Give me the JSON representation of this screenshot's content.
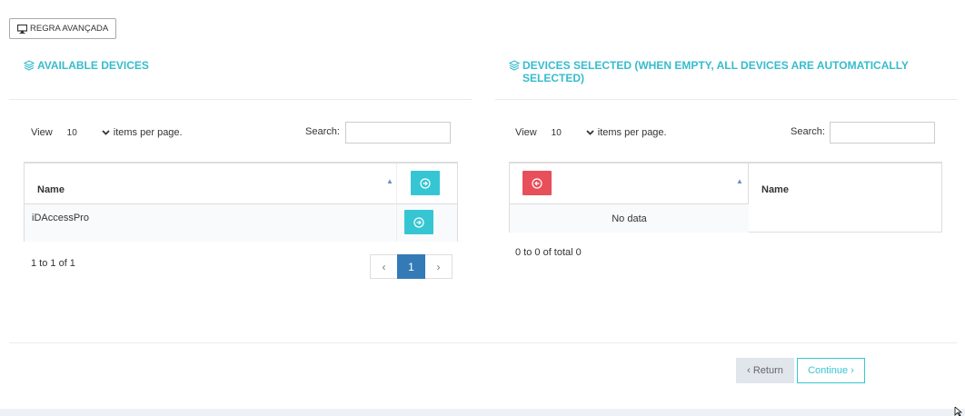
{
  "toolbar": {
    "advanced_rule_label": "REGRA AVANÇADA",
    "advanced_rule_icon": "monitor-icon"
  },
  "available": {
    "title": "AVAILABLE DEVICES",
    "view_label": "View",
    "page_size": "10",
    "items_per_page_label": "items per page.",
    "search_label": "Search:",
    "search_value": "",
    "column_name": "Name",
    "rows": [
      {
        "name": "iDAccessPro"
      }
    ],
    "summary": "1 to 1 of 1",
    "pager": {
      "prev": "‹",
      "current": "1",
      "next": "›"
    }
  },
  "selected": {
    "title": "DEVICES SELECTED (WHEN EMPTY, ALL DEVICES ARE AUTOMATICALLY SELECTED)",
    "view_label": "View",
    "page_size": "10",
    "items_per_page_label": "items per page.",
    "search_label": "Search:",
    "search_value": "",
    "column_name": "Name",
    "empty_text": "No data",
    "summary": "0 to 0 of total 0"
  },
  "footer": {
    "return_label": "‹ Return",
    "continue_label": "Continue ›"
  },
  "colors": {
    "accent": "#36c6d3",
    "title": "#36bccc",
    "danger": "#e7505a",
    "pager_active": "#337ab7"
  }
}
